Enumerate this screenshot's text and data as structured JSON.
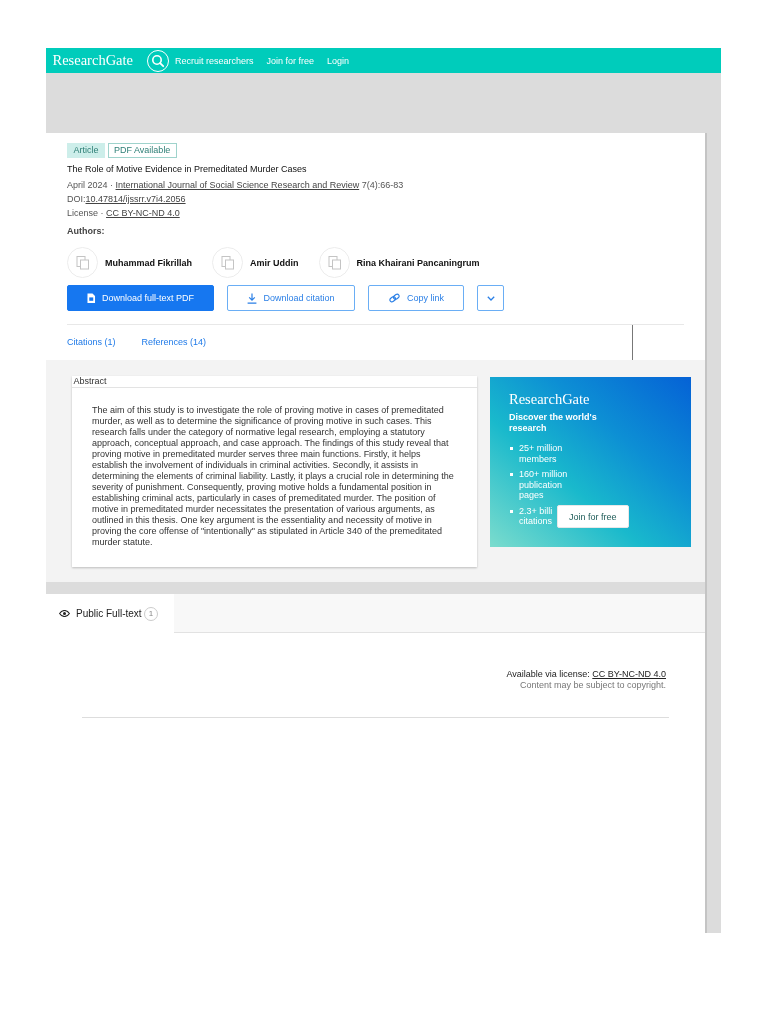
{
  "header": {
    "logo": "ResearchGate",
    "nav": [
      "Recruit researchers",
      "Join for free",
      "Login"
    ]
  },
  "article": {
    "badges": [
      {
        "label": "Article",
        "kind": "filled"
      },
      {
        "label": "PDF Available",
        "kind": "outlined"
      }
    ],
    "title": "The Role of Motive Evidence in Premeditated Murder Cases",
    "date": "April 2024 ·",
    "journal": "International Journal of Social Science Research and Review",
    "pages": "7(4):66-83",
    "doi_label": "DOI:",
    "doi": "10.47814/ijssrr.v7i4.2056",
    "license_label": "License ·",
    "license": "CC BY-NC-ND 4.0",
    "authors_label": "Authors:",
    "authors": [
      "Muhammad Fikrillah",
      "Amir Uddin",
      "Rina Khairani Pancaningrum"
    ],
    "actions": [
      {
        "kind": "pdf",
        "label": "Download full-text PDF"
      },
      {
        "kind": "citation",
        "label": "Download citation"
      },
      {
        "kind": "link",
        "label": "Copy link"
      },
      {
        "kind": "more"
      }
    ],
    "tabs": [
      {
        "label": "Citations (1)",
        "selected": false
      },
      {
        "label": "References (14)",
        "selected": false
      }
    ]
  },
  "abstract": {
    "heading": "Abstract",
    "text": "The aim of this study is to investigate the role of proving motive in cases of premeditated murder, as well as to determine the significance of proving motive in such cases. This research falls under the category of normative legal research, employing a statutory approach, conceptual approach, and case approach. The findings of this study reveal that proving motive in premeditated murder serves three main functions. Firstly, it helps establish the involvement of individuals in criminal activities. Secondly, it assists in determining the elements of criminal liability. Lastly, it plays a crucial role in determining the severity of punishment. Consequently, proving motive holds a fundamental position in establishing criminal acts, particularly in cases of premeditated murder. The position of motive in premeditated murder necessitates the presentation of various arguments, as outlined in this thesis. One key argument is the essentiality and necessity of motive in proving the core offense of \"intentionally\" as stipulated in Article 340 of the premeditated murder statute."
  },
  "promo": {
    "logo": "ResearchGate",
    "tagline": "Discover the world's research",
    "stats": [
      "25+ million members",
      "160+ million publication pages",
      "2.3+ billi citations"
    ],
    "button": "Join for free"
  },
  "full_text": {
    "tabs": [
      {
        "label": "Public Full-text",
        "count": "1",
        "selected": true
      }
    ],
    "license_label": "Available via license:",
    "license": "CC BY-NC-ND 4.0",
    "note": "Content may be subject to copyright."
  }
}
